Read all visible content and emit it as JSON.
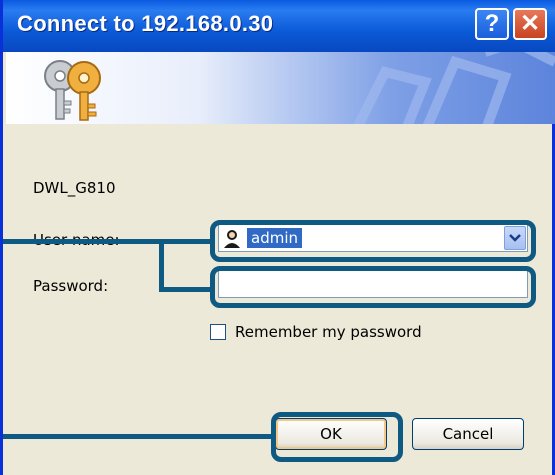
{
  "window": {
    "title": "Connect to 192.168.0.30",
    "help_label": "?",
    "close_label": "✕"
  },
  "dialog": {
    "server_name": "DWL_G810",
    "username_label": "User name:",
    "username_value": "admin",
    "password_label": "Password:",
    "password_value": "",
    "remember_label": "Remember my password",
    "remember_checked": false,
    "ok_label": "OK",
    "cancel_label": "Cancel"
  },
  "icons": {
    "banner": "keys-icon",
    "user": "user-icon",
    "dropdown": "chevron-down-icon"
  },
  "colors": {
    "titlebar": "#0b5ad8",
    "annotation": "#0e5a83",
    "selection": "#316ac5"
  }
}
